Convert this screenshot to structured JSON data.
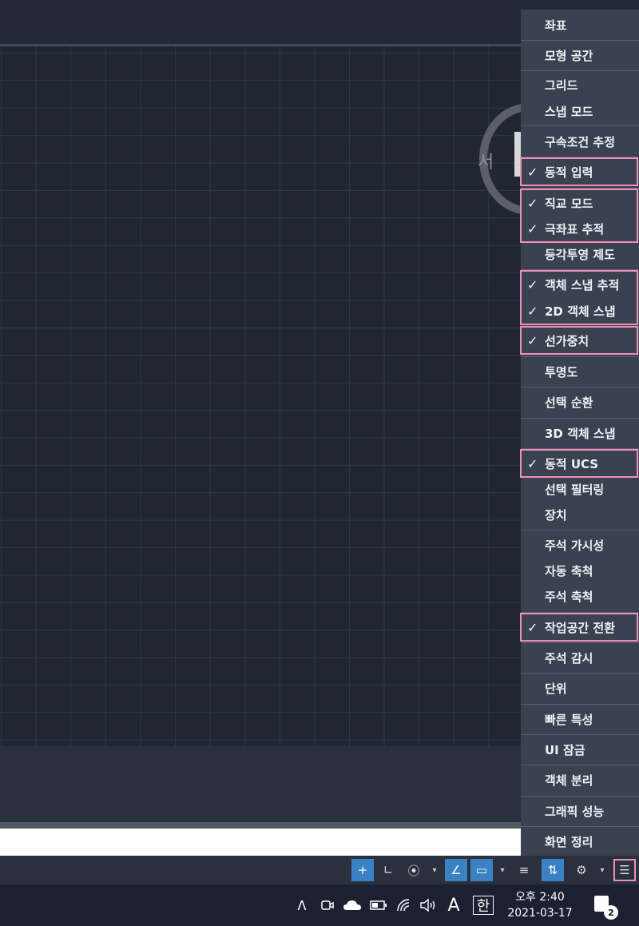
{
  "canvas": {
    "viewcube_compass": "서"
  },
  "menu": {
    "items": [
      {
        "label": "좌표",
        "checked": false
      },
      {
        "label": "모형 공간",
        "checked": false
      },
      {
        "label": "그리드",
        "checked": false
      },
      {
        "label": "스냅 모드",
        "checked": false
      },
      {
        "label": "구속조건 추정",
        "checked": false
      },
      {
        "label": "동적 입력",
        "checked": true
      },
      {
        "label": "직교 모드",
        "checked": true
      },
      {
        "label": "극좌표 추적",
        "checked": true
      },
      {
        "label": "등각투영 제도",
        "checked": false
      },
      {
        "label": "객체 스냅 추적",
        "checked": true
      },
      {
        "label": "2D 객체 스냅",
        "checked": true
      },
      {
        "label": "선가중치",
        "checked": true
      },
      {
        "label": "투명도",
        "checked": false
      },
      {
        "label": "선택 순환",
        "checked": false
      },
      {
        "label": "3D 객체 스냅",
        "checked": false
      },
      {
        "label": "동적 UCS",
        "checked": true
      },
      {
        "label": "선택 필터링",
        "checked": false
      },
      {
        "label": "장치",
        "checked": false
      },
      {
        "label": "주석 가시성",
        "checked": false
      },
      {
        "label": "자동 축척",
        "checked": false
      },
      {
        "label": "주석 축척",
        "checked": false
      },
      {
        "label": "작업공간 전환",
        "checked": true
      },
      {
        "label": "주석 감시",
        "checked": false
      },
      {
        "label": "단위",
        "checked": false
      },
      {
        "label": "빠른 특성",
        "checked": false
      },
      {
        "label": "UI 잠금",
        "checked": false
      },
      {
        "label": "객체 분리",
        "checked": false
      },
      {
        "label": "그래픽 성능",
        "checked": false
      },
      {
        "label": "화면 정리",
        "checked": false
      }
    ],
    "check_mark": "✓"
  },
  "statusbar": {
    "icons": [
      {
        "name": "dynamic-input-icon",
        "glyph": "+",
        "on": true
      },
      {
        "name": "ortho-mode-icon",
        "glyph": "∟",
        "on": false
      },
      {
        "name": "polar-tracking-icon",
        "glyph": "⦿",
        "on": false
      },
      {
        "name": "isometric-icon",
        "glyph": "∠",
        "on": true
      },
      {
        "name": "object-snap-icon",
        "glyph": "▭",
        "on": true
      },
      {
        "name": "lineweight-icon",
        "glyph": "≡",
        "on": false
      },
      {
        "name": "dynamic-ucs-icon",
        "glyph": "⇅",
        "on": true
      },
      {
        "name": "gear-icon",
        "glyph": "⚙",
        "on": false
      },
      {
        "name": "customization-menu-icon",
        "glyph": "☰",
        "on": false
      }
    ],
    "arrow": "▾"
  },
  "taskbar": {
    "tray_up": "ᐱ",
    "ime_mode": "A",
    "ime_lang": "한",
    "time": "오후 2:40",
    "date": "2021-03-17",
    "notification_count": "2"
  },
  "colors": {
    "highlight": "#f18fb6",
    "toggle_on": "#3b82c4"
  }
}
